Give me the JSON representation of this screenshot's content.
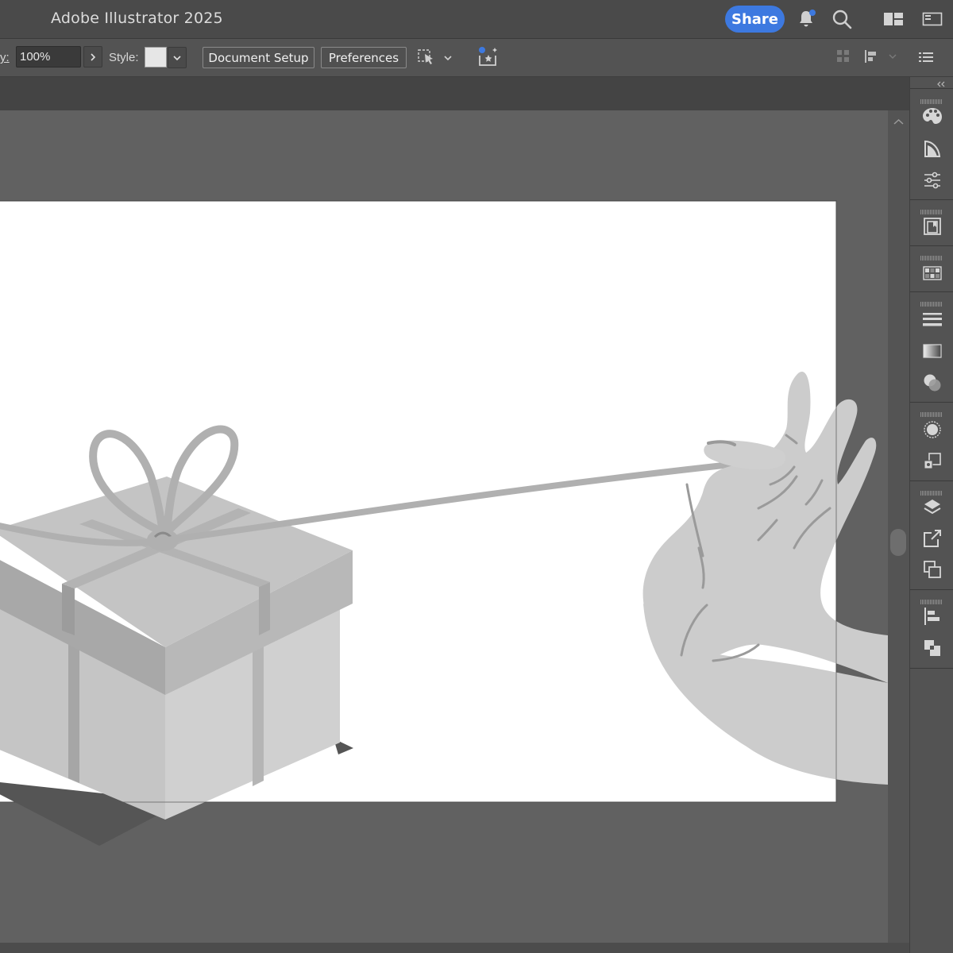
{
  "window": {
    "title": "Adobe Illustrator 2025"
  },
  "titlebar": {
    "share_label": "Share",
    "icons": [
      "notification-bell-icon",
      "search-icon",
      "workspace-switcher-icon",
      "panel-layout-icon"
    ]
  },
  "control_bar": {
    "opacity_label_partial": "y:",
    "opacity_value": "100%",
    "style_label": "Style:",
    "style_swatch_color": "#e6e6e6",
    "document_setup_label": "Document Setup",
    "preferences_label": "Preferences"
  },
  "right_panel": {
    "icons": [
      "color-palette-icon",
      "color-guide-icon",
      "properties-sliders-icon",
      "libraries-icon",
      "swatches-icon",
      "stroke-icon",
      "gradient-icon",
      "transparency-icon",
      "appearance-icon",
      "graphic-styles-icon",
      "layers-icon",
      "export-asset-icon",
      "artboards-icon",
      "align-icon",
      "pathfinder-icon"
    ]
  },
  "colors": {
    "accent": "#3d79e0",
    "ui_dark": "#535353",
    "canvas_bg": "#616161",
    "artboard": "#ffffff"
  }
}
